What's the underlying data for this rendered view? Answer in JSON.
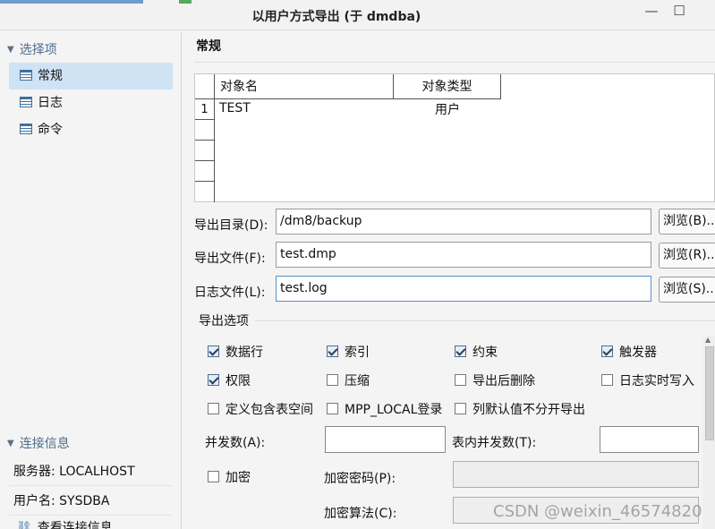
{
  "window": {
    "title": "以用户方式导出 (于 dmdba)",
    "minimize_glyph": "—",
    "maximize_glyph": "☐"
  },
  "sidebar": {
    "select_header": "选择项",
    "items": [
      {
        "label": "常规",
        "icon": "page-icon"
      },
      {
        "label": "日志",
        "icon": "page-icon"
      },
      {
        "label": "命令",
        "icon": "page-icon"
      }
    ],
    "conn_header": "连接信息",
    "server": "服务器: LOCALHOST",
    "user": "用户名: SYSDBA",
    "view_conn": "查看连接信息"
  },
  "main": {
    "heading": "常规",
    "table": {
      "columns": [
        "对象名",
        "对象类型"
      ],
      "rows": [
        {
          "num": "1",
          "name": "TEST",
          "type": "用户"
        }
      ]
    },
    "fields": {
      "dir_label": "导出目录(D):",
      "dir_value": "/dm8/backup",
      "dir_browse": "浏览(B)...",
      "file_label": "导出文件(F):",
      "file_value": "test.dmp",
      "file_browse": "浏览(R)...",
      "log_label": "日志文件(L):",
      "log_value": "test.log",
      "log_browse": "浏览(S)..."
    },
    "options": {
      "legend": "导出选项",
      "rows": "数据行",
      "index": "索引",
      "constraint": "约束",
      "trigger": "触发器",
      "grant": "权限",
      "compress": "压缩",
      "drop_after": "导出后删除",
      "log_realtime": "日志实时写入",
      "tablespace": "定义包含表空间",
      "mpp_local": "MPP_LOCAL登录",
      "no_default": "列默认值不分开导出",
      "parallel_label": "并发数(A):",
      "table_parallel_label": "表内并发数(T):",
      "encrypt": "加密",
      "encrypt_pwd_label": "加密密码(P):",
      "encrypt_algo_label": "加密算法(C):"
    }
  },
  "watermark": "CSDN @weixin_46574820"
}
